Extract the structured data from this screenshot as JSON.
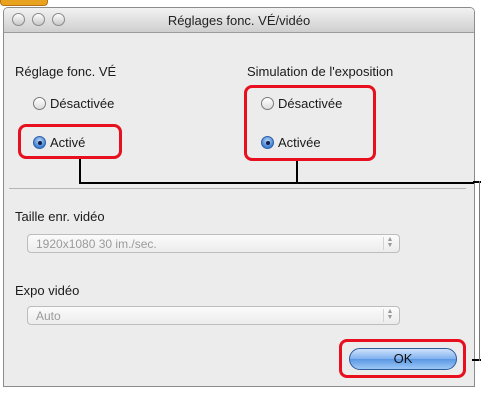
{
  "window": {
    "title": "Réglages fonc. VÉ/vidéo"
  },
  "live_view": {
    "label": "Réglage fonc. VÉ",
    "options": [
      {
        "label": "Désactivée",
        "selected": false
      },
      {
        "label": "Activé",
        "selected": true
      }
    ]
  },
  "exposure_sim": {
    "label": "Simulation de l'exposition",
    "options": [
      {
        "label": "Désactivée",
        "selected": false
      },
      {
        "label": "Activée",
        "selected": true
      }
    ]
  },
  "movie_size": {
    "label": "Taille enr. vidéo",
    "value": "1920x1080 30 im./sec."
  },
  "movie_exposure": {
    "label": "Expo vidéo",
    "value": "Auto"
  },
  "ok_button": {
    "label": "OK"
  },
  "colors": {
    "highlight": "#e8101e",
    "tab": "#e9a21f",
    "button": "#5a97e4"
  }
}
